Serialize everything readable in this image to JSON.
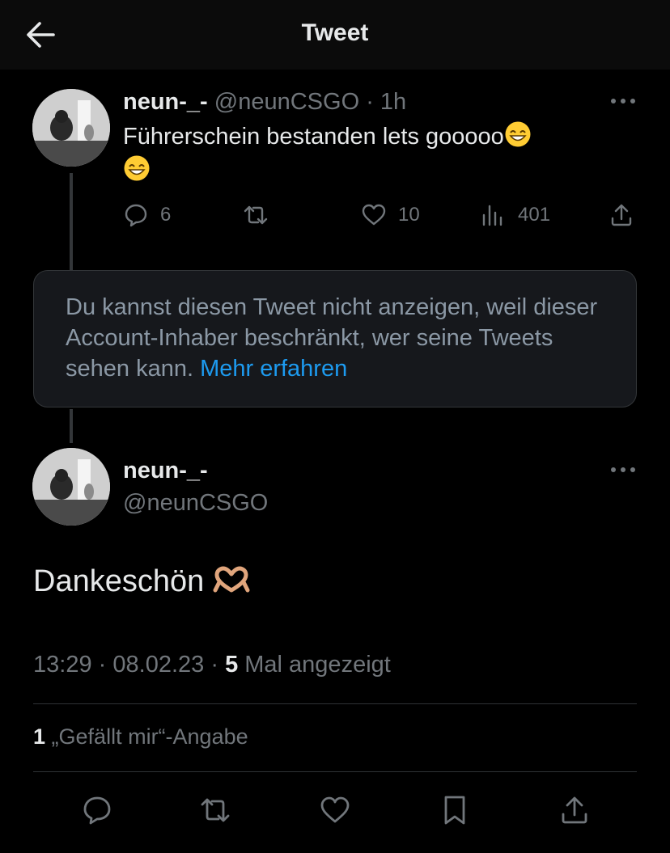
{
  "header": {
    "title": "Tweet",
    "back_icon": "arrow-left-icon"
  },
  "parent_tweet": {
    "name": "neun-_-",
    "handle": "@neunCSGO",
    "time": "· 1h",
    "text": "Führerschein bestanden lets gooooo",
    "emoji": "grinning-face-emoji",
    "actions": {
      "reply": {
        "icon": "reply-icon",
        "count": "6"
      },
      "retweet": {
        "icon": "retweet-icon",
        "count": ""
      },
      "like": {
        "icon": "heart-icon",
        "count": "10"
      },
      "views": {
        "icon": "views-chart-icon",
        "count": "401"
      },
      "share": {
        "icon": "share-icon"
      }
    }
  },
  "notice": {
    "text": "Du kannst diesen Tweet nicht anzeigen, weil dieser Account-Inhaber beschränkt, wer seine Tweets sehen kann.",
    "link": "Mehr erfahren"
  },
  "reply_tweet": {
    "name": "neun-_-",
    "handle": "@neunCSGO",
    "text": "Dankeschön",
    "emoji": "heart-hands-emoji",
    "time": "13:29",
    "separator": "·",
    "date": "08.02.23",
    "views_count": "5",
    "views_label": "Mal angezeigt",
    "likes_count": "1",
    "likes_label": "„Gefällt mir“-Angabe"
  },
  "bottom_actions": [
    "reply-icon",
    "retweet-icon",
    "heart-icon",
    "bookmark-icon",
    "share-icon"
  ],
  "colors": {
    "background": "#000000",
    "text": "#e7e9ea",
    "secondary": "#71767b",
    "link": "#1d9bf0",
    "notice_bg": "#16181c",
    "border": "#333639"
  }
}
